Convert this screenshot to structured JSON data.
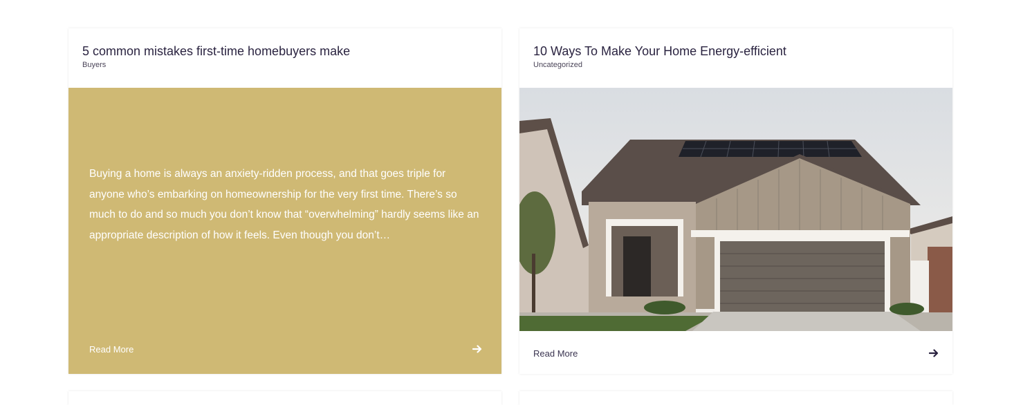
{
  "posts": [
    {
      "title": "5 common mistakes first-time homebuyers make",
      "category": "Buyers",
      "excerpt": "Buying a home is always an anxiety-ridden process, and that goes triple for anyone who’s embarking on homeownership for the very first time. There’s so much to do and so much you don’t know that “overwhelming” hardly seems like an appropriate description of how it feels. Even though you don’t…",
      "read_more": "Read More",
      "arrow_icon": "arrow-right-icon",
      "panel_color": "#cfb974"
    },
    {
      "title": "10 Ways To Make Your Home Energy-efficient",
      "category": "Uncategorized",
      "read_more": "Read More",
      "arrow_icon": "arrow-right-icon",
      "image": "house-with-solar-panels-photo"
    }
  ],
  "colors": {
    "title": "#2a2340",
    "accent_gold": "#cfb974"
  }
}
